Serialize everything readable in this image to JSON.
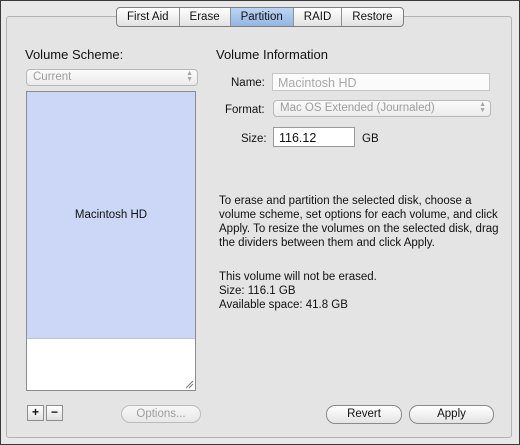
{
  "tabs": [
    "First Aid",
    "Erase",
    "Partition",
    "RAID",
    "Restore"
  ],
  "active_tab_index": 2,
  "volume_scheme": {
    "heading": "Volume Scheme:",
    "popup_value": "Current",
    "volume_label": "Macintosh HD",
    "add_label": "+",
    "remove_label": "−",
    "options_label": "Options..."
  },
  "volume_info": {
    "heading": "Volume Information",
    "name_label": "Name:",
    "name_value": "Macintosh HD",
    "format_label": "Format:",
    "format_value": "Mac OS Extended (Journaled)",
    "size_label": "Size:",
    "size_value": "116.12",
    "size_unit": "GB"
  },
  "instructions": "To erase and partition the selected disk, choose a volume scheme, set options for each volume, and click Apply. To resize the volumes on the selected disk, drag the dividers between them and click Apply.",
  "status": {
    "line1": "This volume will not be erased.",
    "line2": "Size: 116.1 GB",
    "line3": "Available space: 41.8 GB"
  },
  "buttons": {
    "revert": "Revert",
    "apply": "Apply"
  }
}
